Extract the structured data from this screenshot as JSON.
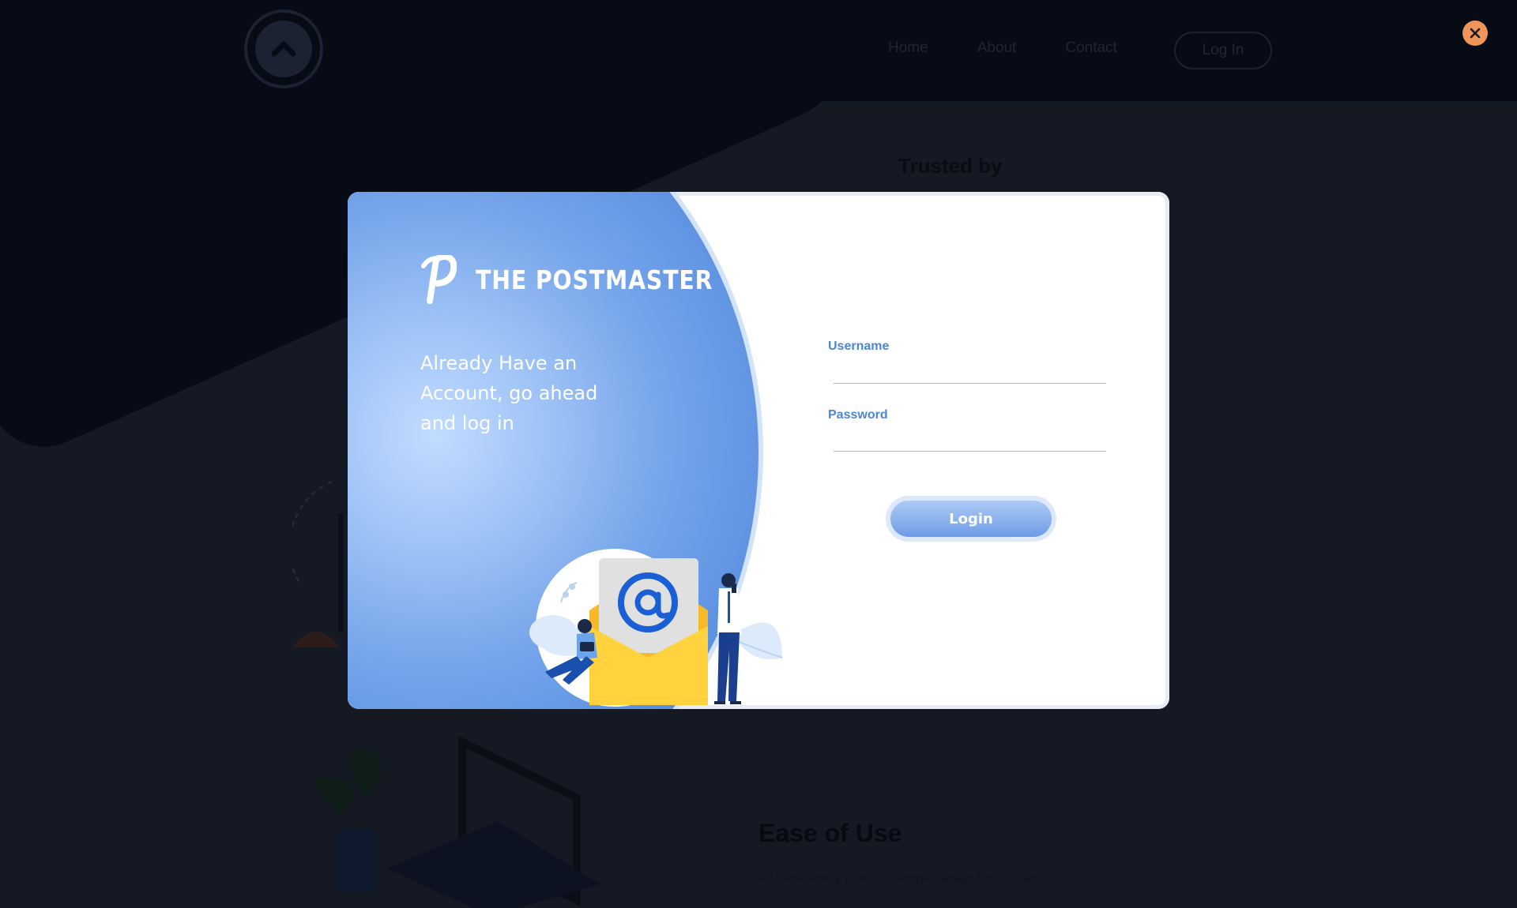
{
  "background": {
    "nav": [
      "Home",
      "About",
      "Contact"
    ],
    "nav_login": "Log In",
    "trusted_heading": "Trusted by",
    "feature_title": "Ease of Use",
    "feature_text": "A User-friendly practice, simple design for effortless"
  },
  "modal": {
    "brand_name": "THE POSTMASTER",
    "tagline": "Already Have an Account, go ahead and log in",
    "username_label": "Username",
    "username_value": "",
    "password_label": "Password",
    "password_value": "",
    "login_label": "Login"
  },
  "icons": {
    "close": "close-icon",
    "brand_logo": "postmaster-p-logo",
    "site_logo": "chevron-up-circle-logo"
  },
  "colors": {
    "accent_blue": "#4a86d6",
    "panel_gradient": "#5a8fe0",
    "close_button": "#f0955a",
    "page_background": "#141923"
  }
}
